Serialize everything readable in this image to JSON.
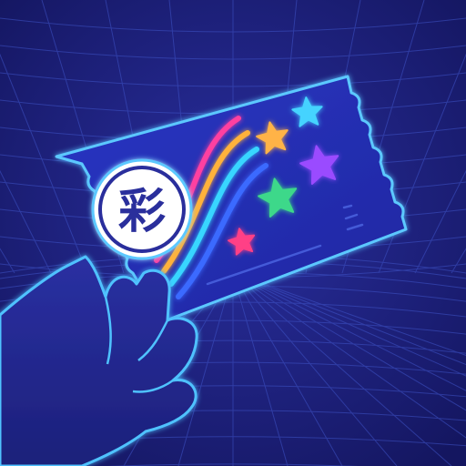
{
  "ticket": {
    "emblem_char": "彩"
  },
  "colors": {
    "background": "#1a1d6e",
    "grid": "#3f54c8",
    "grid_glow": "#5f8cff",
    "ticket_fill": "#2430b0",
    "ticket_edge": "#5cc8ff",
    "hand_fill": "#23298c",
    "hand_edge": "#4fc2ff",
    "emblem_ring": "#2a2f9c",
    "emblem_text": "#2a2f9c",
    "rainbow": [
      "#ff3fa0",
      "#ffb23a",
      "#38d6ff",
      "#3b6bff"
    ],
    "stars": [
      "#ffb347",
      "#45d3ff",
      "#9a4bff",
      "#3ed88a",
      "#ff3f86"
    ]
  },
  "icons": [
    "star-icon",
    "rainbow-icon",
    "hand-icon",
    "emblem-icon"
  ]
}
